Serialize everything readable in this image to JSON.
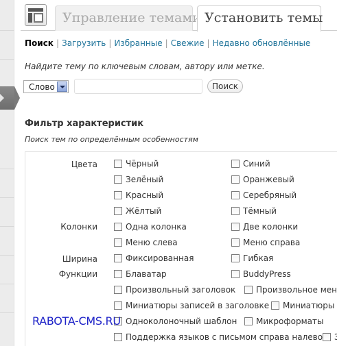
{
  "tabs": {
    "manage": "Управление темами",
    "install": "Установить темы"
  },
  "subnav": {
    "search": "Поиск",
    "upload": "Загрузить",
    "featured": "Избранные",
    "newest": "Свежие",
    "updated": "Недавно обновлённые"
  },
  "search": {
    "hint": "Найдите тему по ключевым словам, автору или метке.",
    "type_selected": "Слово",
    "query_value": "",
    "button": "Поиск"
  },
  "filter": {
    "title": "Фильтр характеристик",
    "subtitle": "Поиск тем по определённым особенностям",
    "groups": {
      "colors": "Цвета",
      "columns": "Колонки",
      "width": "Ширина",
      "features": "Функции"
    },
    "options": {
      "black": "Чёрный",
      "blue": "Синий",
      "green": "Зелёный",
      "orange": "Оранжевый",
      "red": "Красный",
      "silver": "Серебряный",
      "yellow": "Жёлтый",
      "dark": "Тёмный",
      "one_column": "Одна колонка",
      "two_columns": "Две колонки",
      "menu_left": "Меню слева",
      "menu_right": "Меню справа",
      "fixed": "Фиксированная",
      "flexible": "Гибкая",
      "blavatar": "Блаватар",
      "buddypress": "BuddyPress",
      "custom_header": "Произвольный заголовок",
      "custom_menu": "Произвольное меню",
      "header_thumbs": "Миниатюры записей в заголовке",
      "thumbs_cut": "Миниатюры за",
      "single_column_tpl": "Одноколоночный шаблон",
      "microformats": "Микроформаты",
      "rtl": "Поддержка языков с письмом справа налево",
      "cut_last": "З"
    }
  },
  "watermark": "RABOTA-CMS.RU"
}
